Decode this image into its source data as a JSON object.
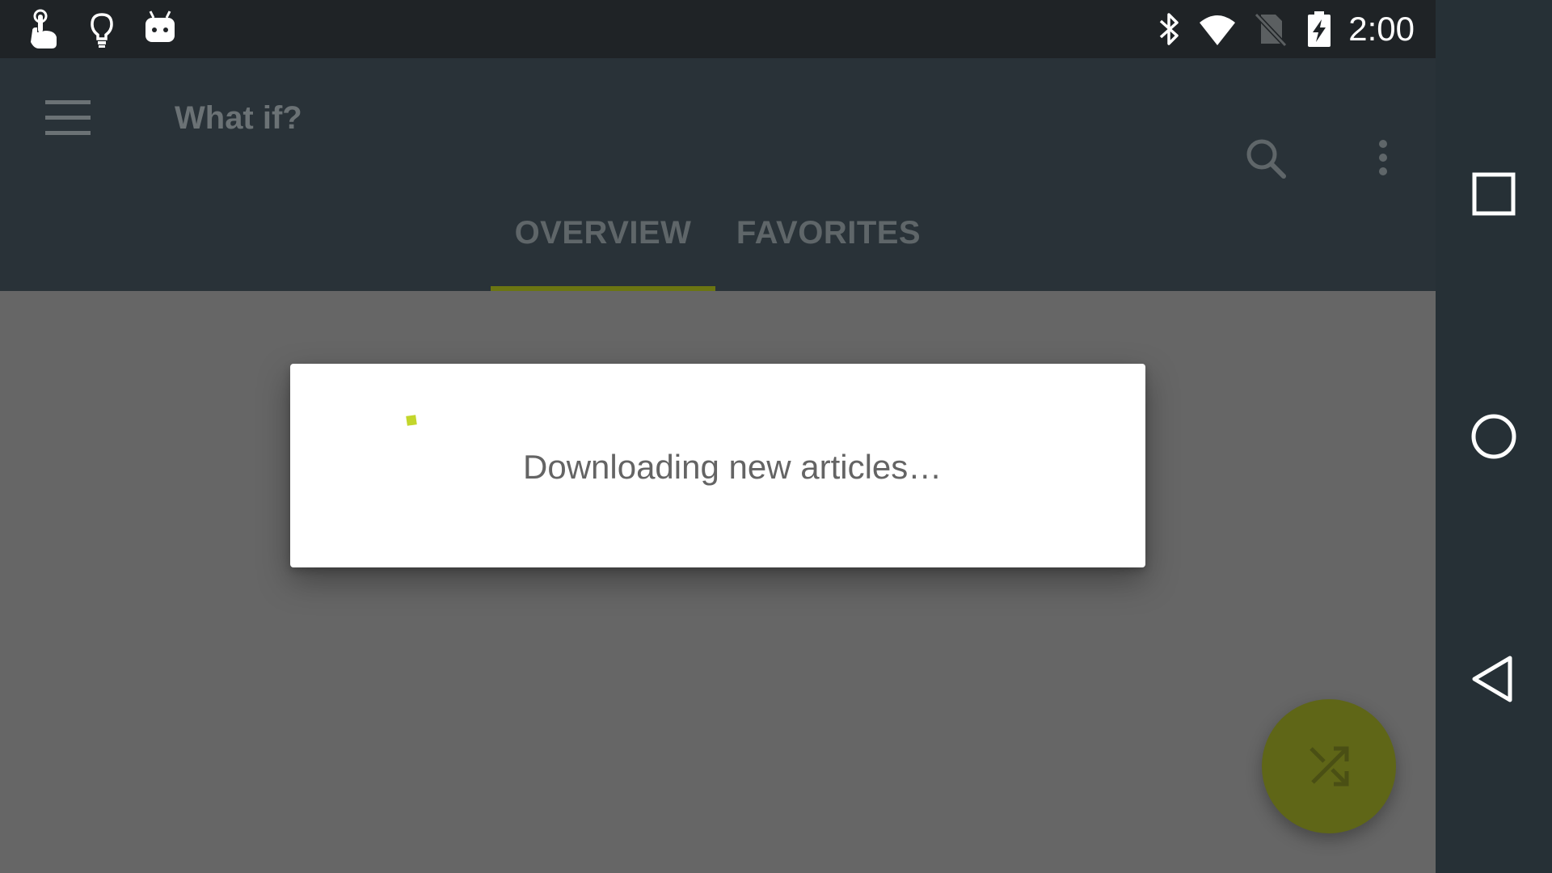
{
  "status_bar": {
    "left_icons": [
      "touch-app-icon",
      "lightbulb-icon",
      "android-debug-icon"
    ],
    "right_icons": [
      "bluetooth-icon",
      "wifi-icon",
      "no-sim-icon",
      "battery-charging-icon"
    ],
    "time": "2:00"
  },
  "toolbar": {
    "menu_icon": "hamburger-menu-icon",
    "title": "What if?",
    "search_icon": "search-icon",
    "overflow_icon": "more-vert-icon"
  },
  "tabs": [
    {
      "label": "OVERVIEW",
      "selected": true
    },
    {
      "label": "FAVORITES",
      "selected": false
    }
  ],
  "dialog": {
    "message": "Downloading new articles…",
    "spinner_color": "#c3d62b"
  },
  "fab": {
    "icon": "shuffle-icon",
    "color": "#5f6617"
  },
  "nav_bar": {
    "buttons": [
      "recents-square-icon",
      "home-circle-icon",
      "back-triangle-icon"
    ]
  },
  "colors": {
    "status_bar": "#1f2326",
    "toolbar": "#293238",
    "scrim_background": "#666666",
    "tab_indicator": "#6b7512",
    "nav_bar": "#263036"
  }
}
